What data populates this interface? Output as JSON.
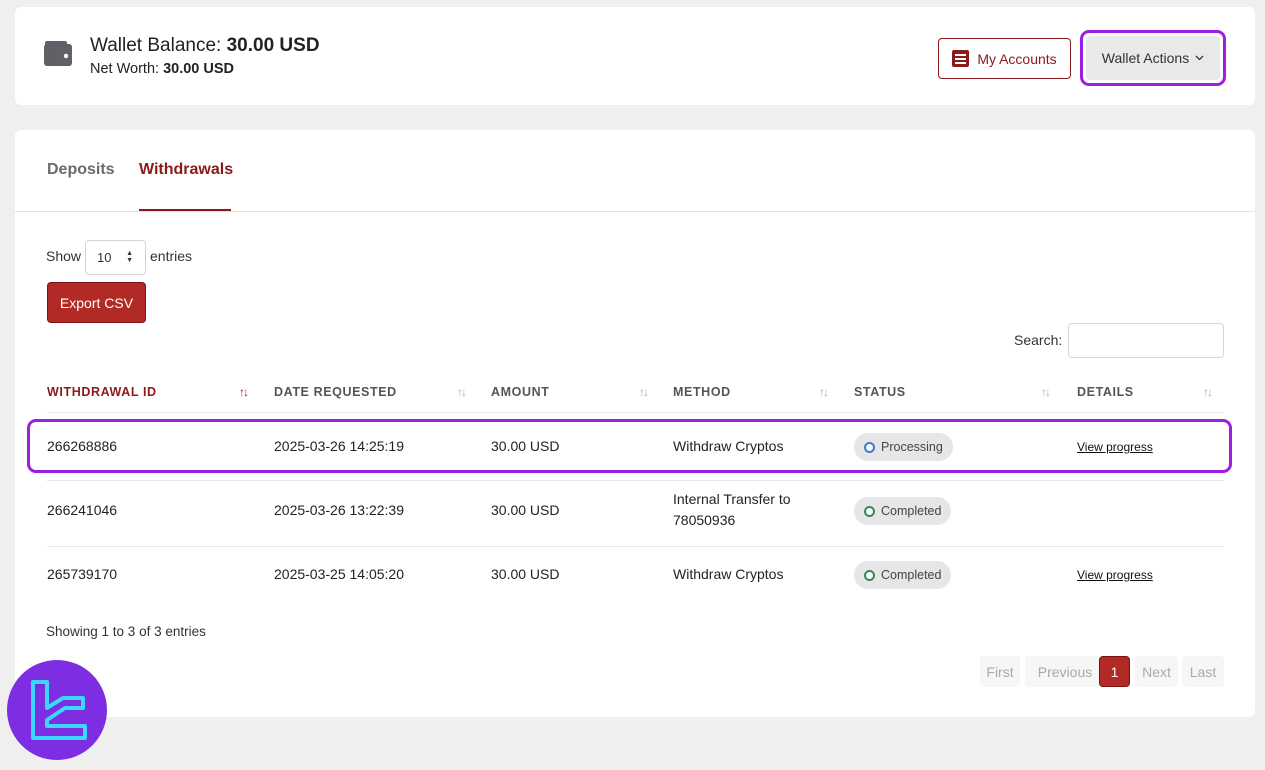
{
  "wallet": {
    "balance_label": "Wallet Balance:",
    "balance_value": "30.00 USD",
    "networth_label": "Net Worth:",
    "networth_value": "30.00 USD"
  },
  "header_buttons": {
    "my_accounts": "My Accounts",
    "wallet_actions": "Wallet Actions"
  },
  "tabs": [
    {
      "label": "Deposits",
      "active": false
    },
    {
      "label": "Withdrawals",
      "active": true
    }
  ],
  "controls": {
    "show_label": "Show",
    "entries_value": "10",
    "entries_label": "entries",
    "export_label": "Export CSV",
    "search_label": "Search:",
    "search_value": ""
  },
  "table": {
    "columns": [
      "WITHDRAWAL ID",
      "DATE REQUESTED",
      "AMOUNT",
      "METHOD",
      "STATUS",
      "DETAILS"
    ],
    "rows": [
      {
        "id": "266268886",
        "date": "2025-03-26 14:25:19",
        "amount": "30.00 USD",
        "method": "Withdraw Cryptos",
        "status": "Processing",
        "details": "View progress"
      },
      {
        "id": "266241046",
        "date": "2025-03-26 13:22:39",
        "amount": "30.00 USD",
        "method": "Internal Transfer to 78050936",
        "status": "Completed",
        "details": ""
      },
      {
        "id": "265739170",
        "date": "2025-03-25 14:05:20",
        "amount": "30.00 USD",
        "method": "Withdraw Cryptos",
        "status": "Completed",
        "details": "View progress"
      }
    ]
  },
  "footer": {
    "showing": "Showing 1 to 3 of 3 entries",
    "pagination": [
      "First",
      "Previous",
      "1",
      "Next",
      "Last"
    ],
    "current_page": "1"
  },
  "colors": {
    "brand": "#8b1a1a",
    "button_red": "#b22a25",
    "highlight": "#9b1fe0",
    "processing_dot": "#3a7bd5",
    "completed_dot": "#2e8b57",
    "logo_bg": "#7d2ee3"
  },
  "icons": {
    "wallet": "wallet-icon",
    "accounts": "list-icon",
    "dropdown": "chevron-down-icon",
    "sort": "sort-arrows-icon"
  }
}
